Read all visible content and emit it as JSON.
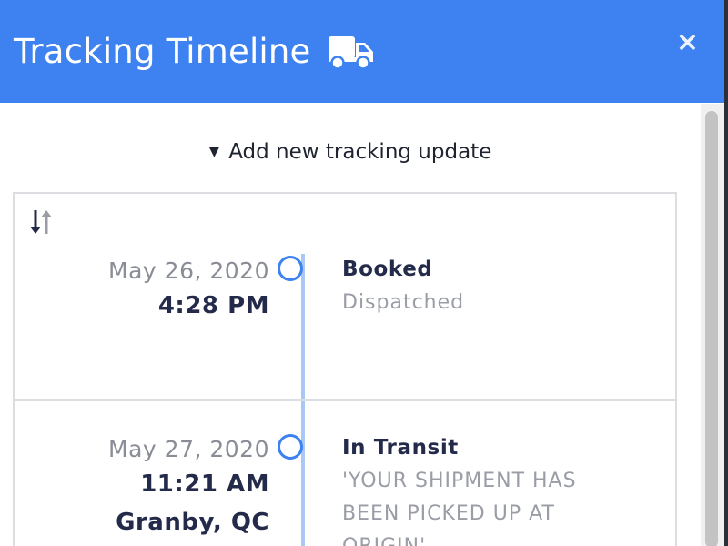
{
  "header": {
    "title": "Tracking Timeline",
    "title_icon": "truck-icon",
    "close_label": "×",
    "color": "#3d82f0"
  },
  "add_update": {
    "label": "Add new tracking update",
    "icon": "caret-down-icon"
  },
  "timeline": {
    "sort_icon": "sort-arrows-icon",
    "line_color": "#a9c8f4",
    "events": [
      {
        "date": "May 26, 2020",
        "time": "4:28 PM",
        "location": "",
        "status": "Booked",
        "detail": "Dispatched"
      },
      {
        "date": "May 27, 2020",
        "time": "11:21 AM",
        "location": "Granby, QC",
        "status": "In Transit",
        "detail": "'YOUR SHIPMENT HAS BEEN PICKED UP AT ORIGIN'"
      }
    ]
  }
}
